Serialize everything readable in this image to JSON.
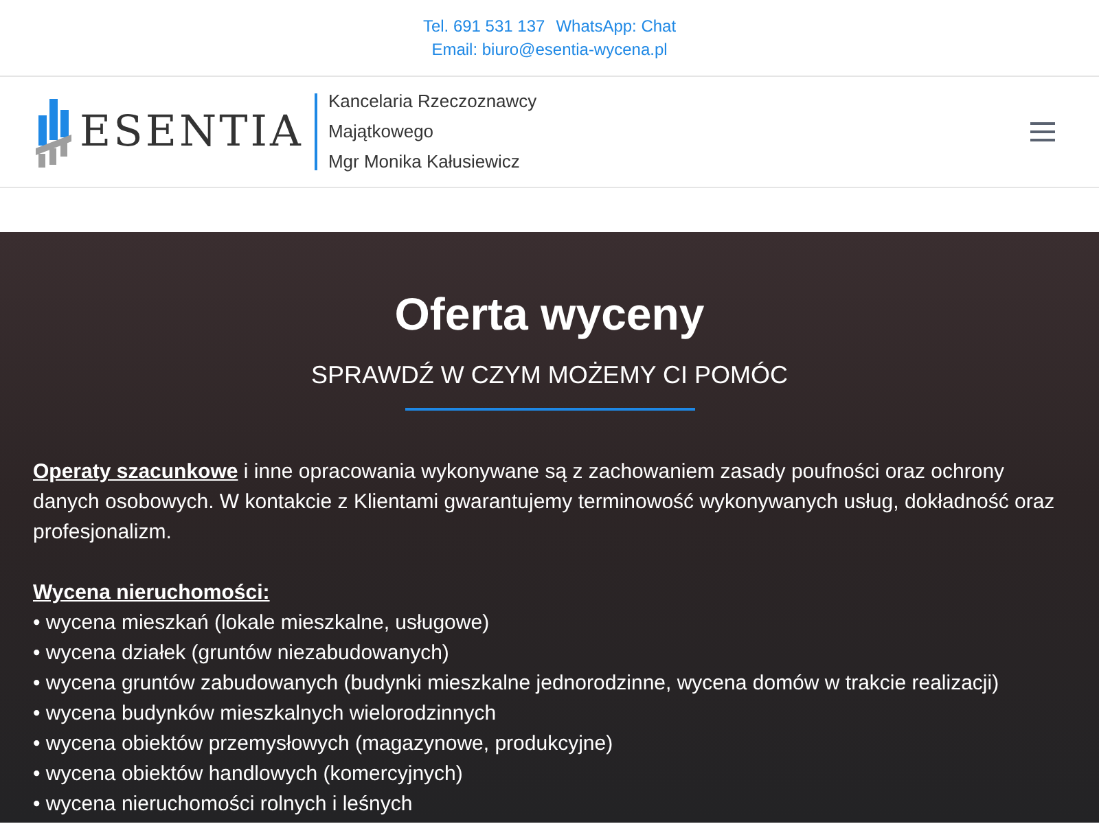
{
  "top_bar": {
    "phone": "Tel. 691 531 137",
    "whatsapp": "WhatsApp: Chat",
    "email": "Email: biuro@esentia-wycena.pl"
  },
  "header": {
    "logo_text": "ESENTIA",
    "tagline": [
      "Kancelaria Rzeczoznawcy",
      "Majątkowego",
      "Mgr Monika Kałusiewicz"
    ]
  },
  "hero": {
    "title": "Oferta wyceny",
    "subtitle": "SPRAWDŹ W CZYM MOŻEMY CI POMÓC",
    "intro": "**Operaty szacunkowe** i inne opracowania wykonywane są z zachowaniem zasady poufności oraz ochrony danych osobowych. W kontakcie z Klientami gwarantujemy terminowość wykonywanych usług, dokładność oraz profesjonalizm.",
    "section_heading": "Wycena nieruchomości:",
    "items": [
      "• wycena mieszkań (lokale mieszkalne, usługowe)",
      "• wycena działek (gruntów niezabudowanych)",
      "• wycena gruntów zabudowanych (budynki mieszkalne jednorodzinne, wycena domów w trakcie realizacji)",
      "• wycena budynków mieszkalnych wielorodzinnych",
      "• wycena obiektów przemysłowych (magazynowe, produkcyjne)",
      "• wycena obiektów handlowych (komercyjnych)",
      "• wycena nieruchomości rolnych i leśnych"
    ]
  }
}
